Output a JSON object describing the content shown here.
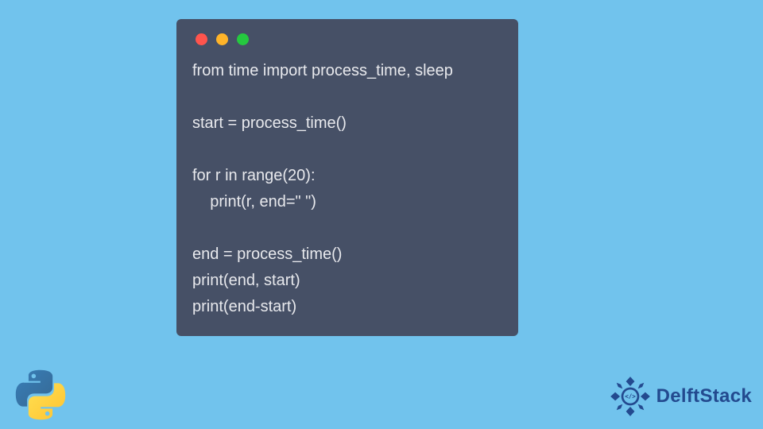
{
  "code": {
    "lines": [
      "from time import process_time, sleep",
      "",
      "start = process_time()",
      "",
      "for r in range(20):",
      "    print(r, end=\" \")",
      "",
      "end = process_time()",
      "print(end, start)",
      "print(end-start)"
    ]
  },
  "brand": {
    "name": "DelftStack"
  },
  "icons": {
    "python": "python-logo",
    "delft": "delft-badge"
  },
  "colors": {
    "bg": "#71c3ed",
    "window": "#465066",
    "text": "#e8e9ed",
    "brand": "#234a8f"
  }
}
